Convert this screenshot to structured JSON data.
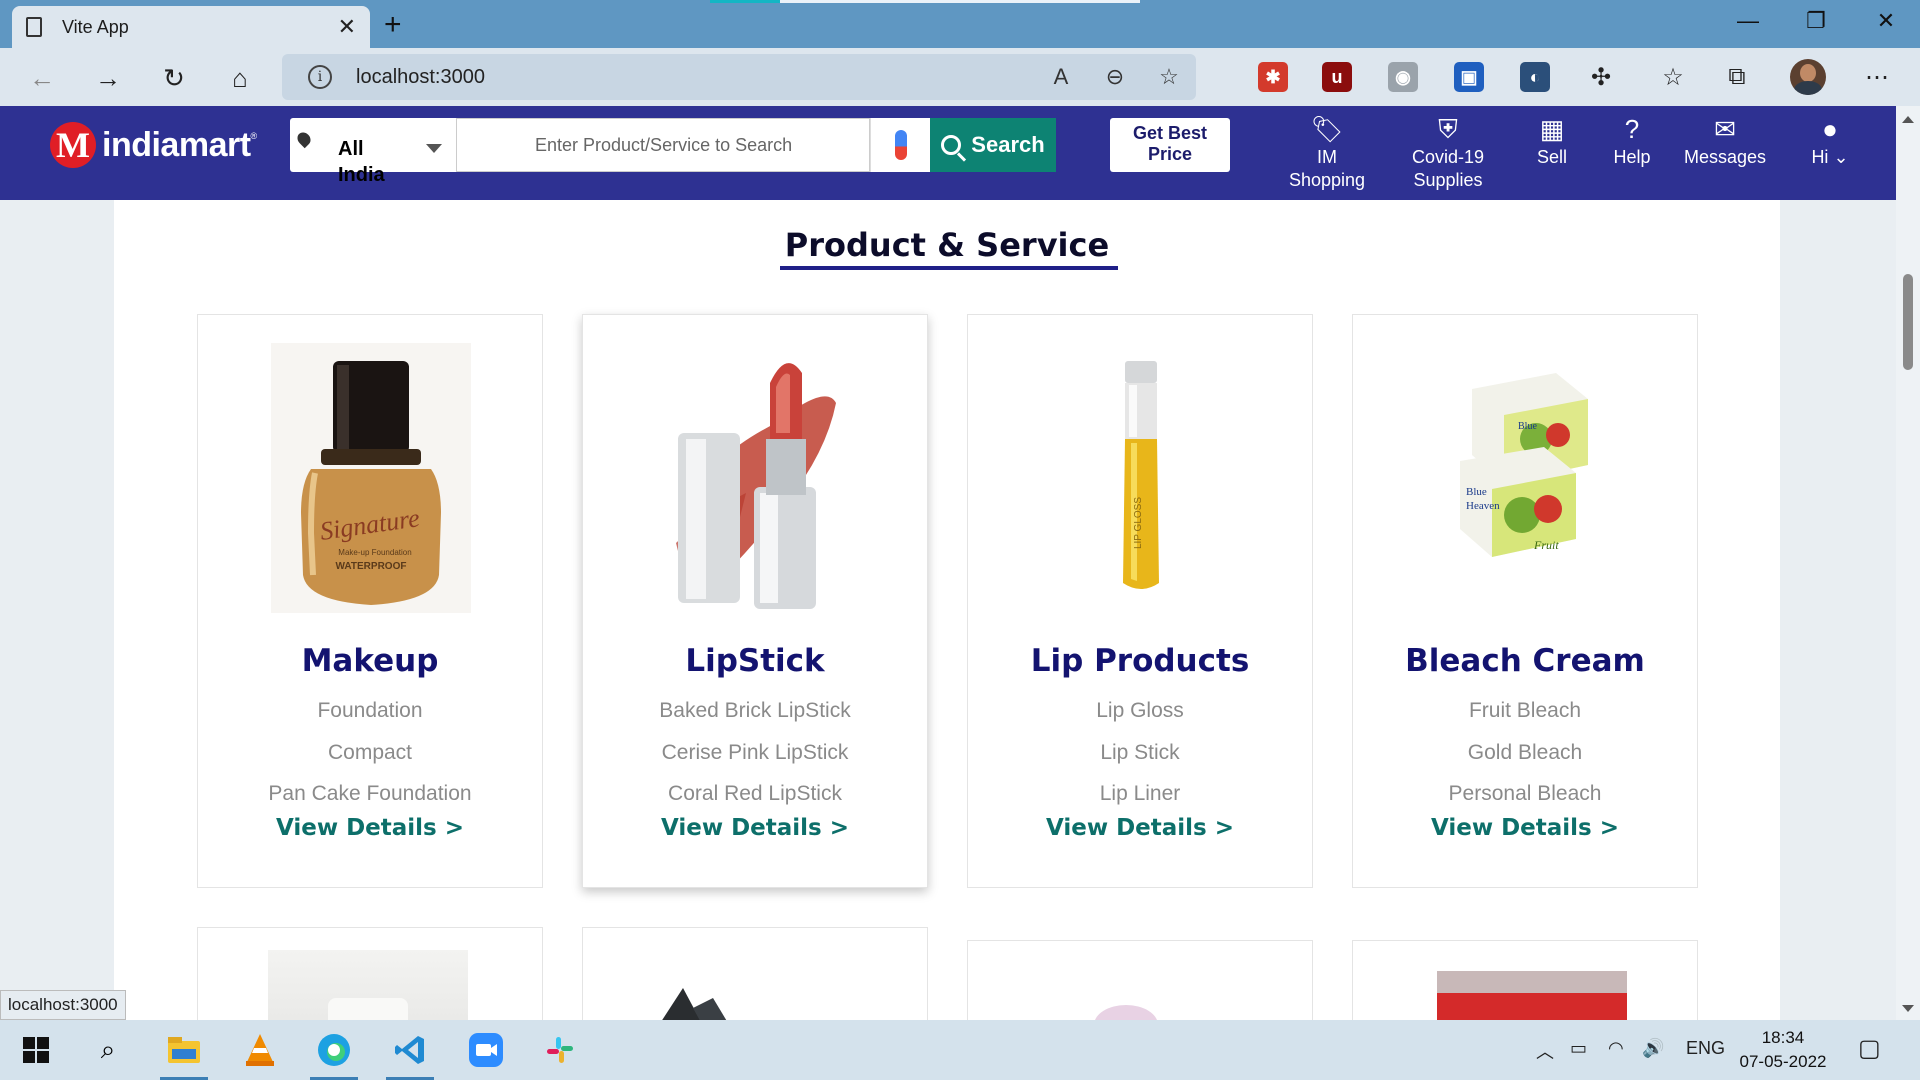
{
  "browser": {
    "tab_title": "Vite App",
    "url": "localhost:3000",
    "status_url": "localhost:3000"
  },
  "header": {
    "logo_text": "indiamart",
    "location": "All India",
    "search_placeholder": "Enter Product/Service to Search",
    "search_button": "Search",
    "best_price_button": "Get Best Price",
    "nav": [
      {
        "label": "IM Shopping",
        "icon": "tag-icon"
      },
      {
        "label": "Covid-19 Supplies",
        "icon": "shield-plus-icon"
      },
      {
        "label": "Sell",
        "icon": "store-icon"
      },
      {
        "label": "Help",
        "icon": "question-icon"
      },
      {
        "label": "Messages",
        "icon": "chat-icon"
      },
      {
        "label": "Hi",
        "icon": "user-icon"
      }
    ]
  },
  "section": {
    "title": "Product & Service"
  },
  "products": [
    {
      "name": "Makeup",
      "items": [
        "Foundation",
        "Compact",
        "Pan Cake Foundation"
      ],
      "link": "View Details >",
      "image": "foundation-bottle"
    },
    {
      "name": "LipStick",
      "items": [
        "Baked Brick LipStick",
        "Cerise Pink LipStick",
        "Coral Red LipStick"
      ],
      "link": "View Details >",
      "image": "lipstick"
    },
    {
      "name": "Lip Products",
      "items": [
        "Lip Gloss",
        "Lip Stick",
        "Lip Liner"
      ],
      "link": "View Details >",
      "image": "lip-gloss-tube"
    },
    {
      "name": "Bleach Cream",
      "items": [
        "Fruit Bleach",
        "Gold Bleach",
        "Personal Bleach"
      ],
      "link": "View Details >",
      "image": "bleach-boxes"
    }
  ],
  "taskbar": {
    "language": "ENG",
    "time": "18:34",
    "date": "07-05-2022"
  },
  "colors": {
    "header_bg": "#2e3192",
    "search_button_bg": "#0d8373",
    "product_name": "#131370",
    "link": "#0d6f6a"
  }
}
